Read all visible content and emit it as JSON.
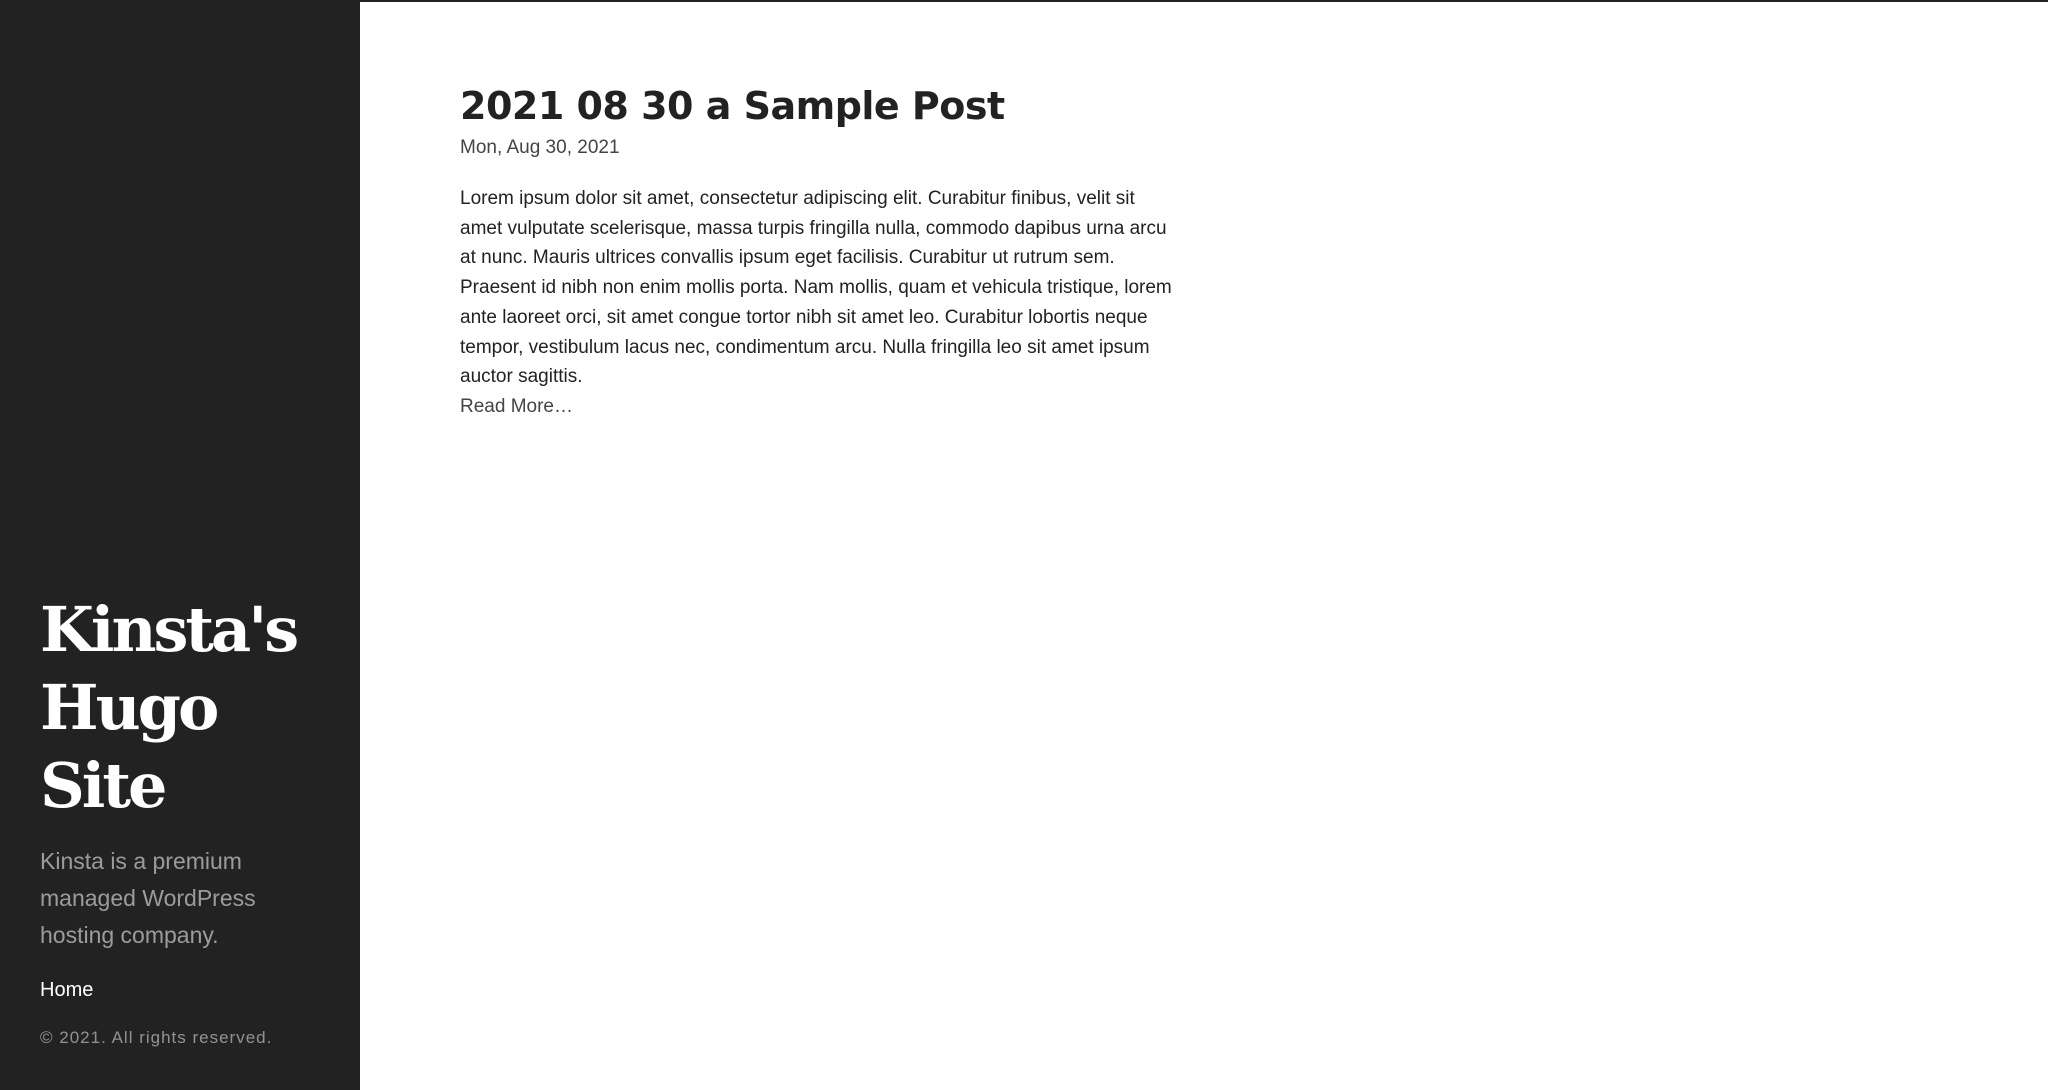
{
  "sidebar": {
    "site_title": "Kinsta's Hugo Site",
    "description": "Kinsta is a premium managed WordPress hosting company.",
    "nav": [
      {
        "label": "Home"
      }
    ],
    "copyright": "© 2021. All rights reserved."
  },
  "post": {
    "title": "2021 08 30 a Sample Post",
    "date": "Mon, Aug 30, 2021",
    "excerpt": "Lorem ipsum dolor sit amet, consectetur adipiscing elit. Curabitur finibus, velit sit amet vulputate scelerisque, massa turpis fringilla nulla, commodo dapibus urna arcu at nunc. Mauris ultrices convallis ipsum eget facilisis. Curabitur ut rutrum sem. Praesent id nibh non enim mollis porta. Nam mollis, quam et vehicula tristique, lorem ante laoreet orci, sit amet congue tortor nibh sit amet leo. Curabitur lobortis neque tempor, vestibulum lacus nec, condimentum arcu. Nulla fringilla leo sit amet ipsum auctor sagittis.",
    "read_more": "Read More…"
  },
  "colors": {
    "sidebar_bg": "#222222",
    "page_bg": "#ffffff",
    "text": "#222222"
  }
}
